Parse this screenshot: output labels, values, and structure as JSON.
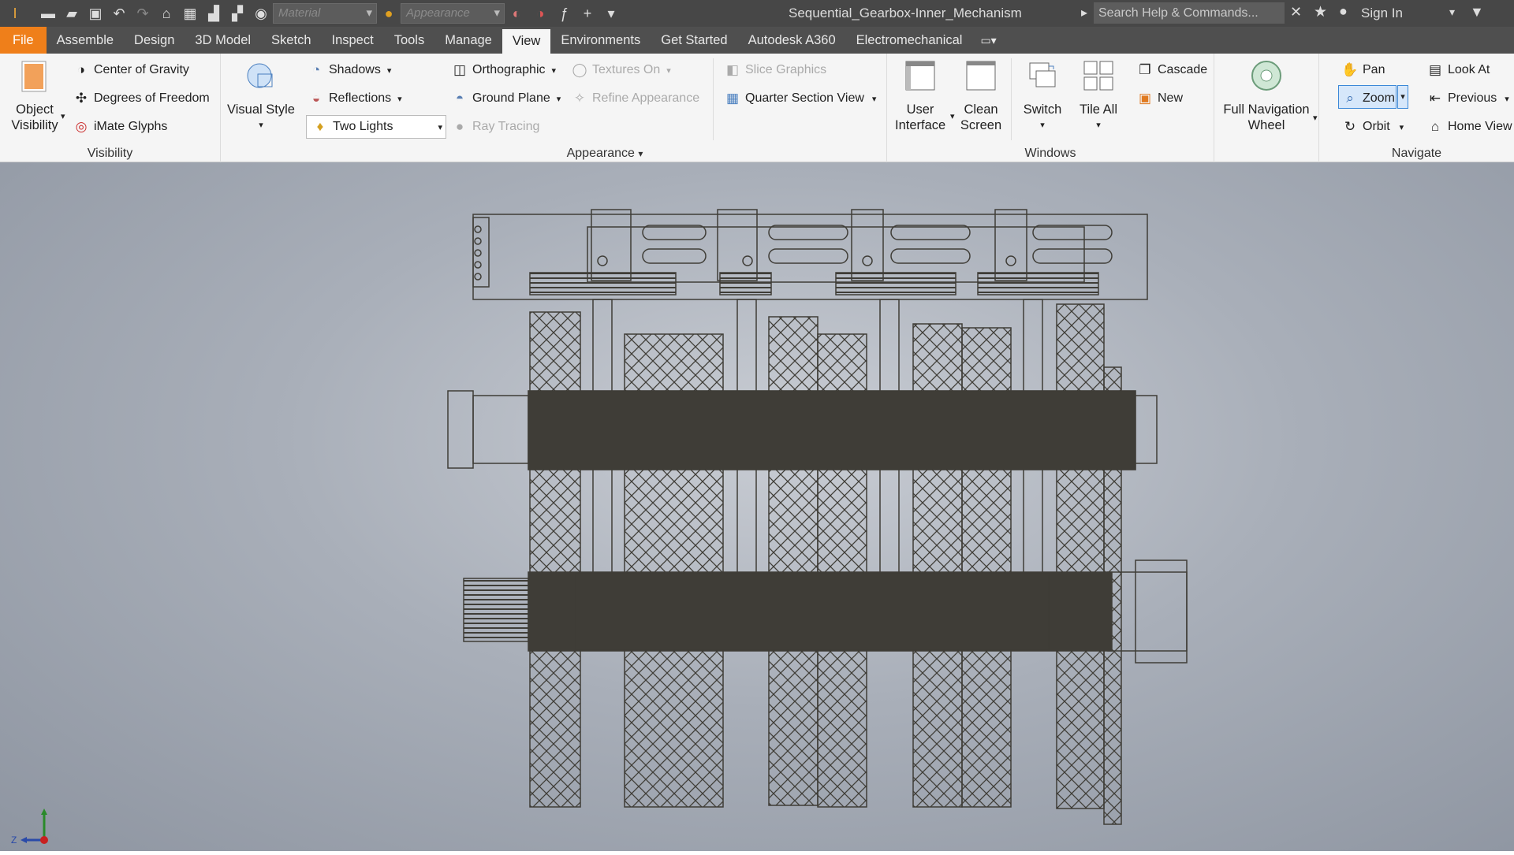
{
  "window": {
    "title": "Sequential_Gearbox-Inner_Mechanism",
    "material_placeholder": "Material",
    "appearance_placeholder": "Appearance",
    "search_placeholder": "Search Help & Commands...",
    "sign_in": "Sign In"
  },
  "tabs": [
    "File",
    "Assemble",
    "Design",
    "3D Model",
    "Sketch",
    "Inspect",
    "Tools",
    "Manage",
    "View",
    "Environments",
    "Get Started",
    "Autodesk A360",
    "Electromechanical"
  ],
  "active_tab": "View",
  "panels": {
    "visibility": {
      "label": "Visibility",
      "object_visibility_line1": "Object",
      "object_visibility_line2": "Visibility",
      "center_of_gravity": "Center of Gravity",
      "degrees_of_freedom": "Degrees of Freedom",
      "imate_glyphs": "iMate Glyphs"
    },
    "appearance": {
      "label": "Appearance",
      "visual_style": "Visual Style",
      "shadows": "Shadows",
      "reflections": "Reflections",
      "lighting": "Two Lights",
      "orthographic": "Orthographic",
      "ground_plane": "Ground Plane",
      "ray_tracing": "Ray Tracing",
      "textures_on": "Textures On",
      "refine_appearance": "Refine Appearance",
      "slice_graphics": "Slice Graphics",
      "quarter_section_view": "Quarter Section View"
    },
    "windows": {
      "label": "Windows",
      "user_interface_line1": "User",
      "user_interface_line2": "Interface",
      "clean_screen_line1": "Clean",
      "clean_screen_line2": "Screen",
      "switch": "Switch",
      "tile_all": "Tile All",
      "cascade": "Cascade",
      "new": "New"
    },
    "navigation_wheel": {
      "line1": "Full Navigation",
      "line2": "Wheel"
    },
    "navigate": {
      "label": "Navigate",
      "pan": "Pan",
      "zoom": "Zoom",
      "orbit": "Orbit",
      "look_at": "Look At",
      "previous": "Previous",
      "home_view": "Home View"
    }
  },
  "colors": {
    "file_tab": "#ef7f1a",
    "title_bar": "#474747",
    "ribbon": "#f5f5f5",
    "model_wire": "#3f3d37",
    "selected": "#3b88d8"
  }
}
